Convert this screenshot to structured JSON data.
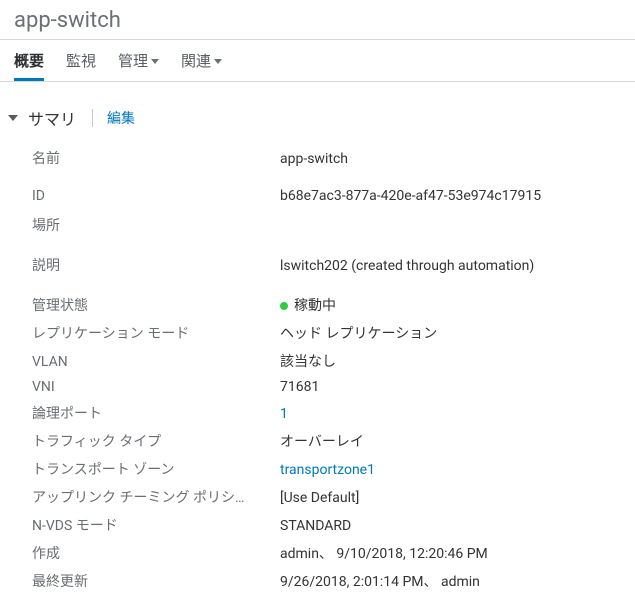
{
  "header": {
    "title": "app-switch"
  },
  "tabs": {
    "overview": "概要",
    "monitor": "監視",
    "manage": "管理",
    "related": "関連"
  },
  "summary": {
    "section_title": "サマリ",
    "edit": "編集",
    "fields": {
      "name_label": "名前",
      "name_value": "app-switch",
      "id_label": "ID",
      "id_value": "b68e7ac3-877a-420e-af47-53e974c17915",
      "location_label": "場所",
      "location_value": "",
      "description_label": "説明",
      "description_value": "lswitch202 (created through automation)",
      "admin_state_label": "管理状態",
      "admin_state_value": "稼動中",
      "replication_mode_label": "レプリケーション モード",
      "replication_mode_value": "ヘッド レプリケーション",
      "vlan_label": "VLAN",
      "vlan_value": "該当なし",
      "vni_label": "VNI",
      "vni_value": "71681",
      "logical_ports_label": "論理ポート",
      "logical_ports_value": "1",
      "traffic_type_label": "トラフィック タイプ",
      "traffic_type_value": "オーバーレイ",
      "transport_zone_label": "トランスポート ゾーン",
      "transport_zone_value": "transportzone1",
      "uplink_teaming_policy_label": "アップリンク チーミング ポリシ…",
      "uplink_teaming_policy_value": "[Use Default]",
      "nvds_mode_label": "N-VDS モード",
      "nvds_mode_value": "STANDARD",
      "created_label": "作成",
      "created_value": "admin、 9/10/2018, 12:20:46 PM",
      "last_modified_label": "最終更新",
      "last_modified_value": "9/26/2018, 2:01:14 PM、 admin"
    }
  }
}
